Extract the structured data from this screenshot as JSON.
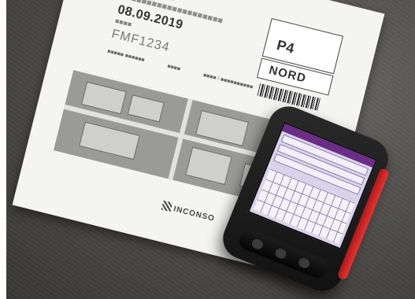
{
  "scene": {
    "description_labels": {
      "paper_date": "08.09.2019",
      "paper_plate": "FMF1234",
      "paper_box_p4": "P4",
      "paper_box_nord": "NORD",
      "paper_logo": "INCONSO"
    }
  }
}
